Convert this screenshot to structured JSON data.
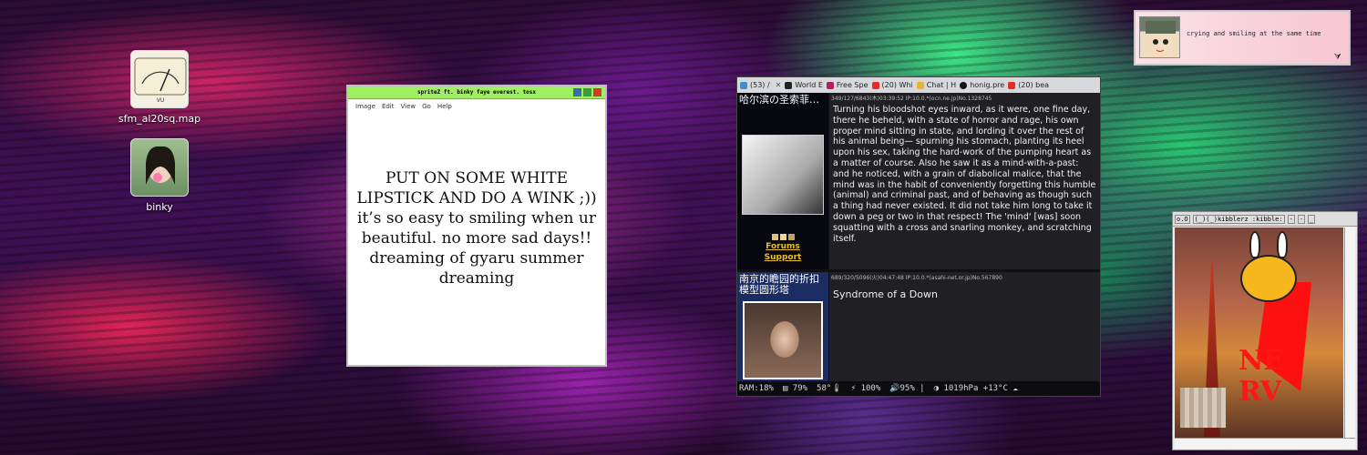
{
  "desktop": {
    "icons": [
      {
        "label": "sfm_al20sq.map",
        "icon": "vu-meter-icon"
      },
      {
        "label": "binky",
        "icon": "photo-icon"
      }
    ]
  },
  "viewer": {
    "title": "spriteZ ft. binky faye everest. tosx",
    "menu": [
      "Image",
      "Edit",
      "View",
      "Go",
      "Help"
    ],
    "text": "PUT ON SOME WHITE LIPSTICK AND DO A WINK ;)) it’s so easy to smiling when ur beautiful. no more sad days!! dreaming of gyaru summer dreaming"
  },
  "browser": {
    "tabs": [
      "(53) /",
      "World E",
      "Free Spe",
      "(20) Whi",
      "Chat | H",
      "honig.pre",
      "(20) bea"
    ],
    "posts": [
      {
        "side_title": "哈尔滨の圣索菲亚大教堂的贷款利…",
        "meta": "349/127/6843(木)03:39:52 IP:10.0.*(ocn.ne.jp)No.1328745",
        "forums_label": "Forums",
        "support_label": "Support",
        "body": "Turning his bloodshot eyes inward, as it were, one fine day, there he beheld, with a state of horror and rage, his own proper mind sitting in state, and lording it over the rest of his animal being— spurning his stomach, planting its heel upon his sex, taking the hard-work of the pumping heart as a matter of course. Also he saw it as a mind-with-a-past: and he noticed, with a grain of diabolical malice, that the mind was in the habit of conveniently forgetting this humble (animal) and criminal past, and of behaving as though such a thing had never existed. It did not take him long to take it down a peg or two in that respect! The 'mind' [was] soon squatting with a cross and snarling monkey, and scratching itself."
      },
      {
        "side_title": "南京的瞻园的折扣模型圆形塔",
        "meta": "689/320/5096(火)04:47:48 IP:10.0.*(asahi-net.or.jp)No.567890",
        "body": "Syndrome of a Down"
      }
    ],
    "status": {
      "ram": "RAM:18%",
      "disk": "79%",
      "temp": "58°",
      "power": "100%",
      "volume": "95%",
      "weather": "1019hPa +13°C"
    }
  },
  "notification": {
    "message": "crying and smiling at the same time"
  },
  "term": {
    "title_parts": [
      "o.O",
      "(_)(_)kibblerz :kibble:",
      "-",
      "-",
      "_"
    ]
  }
}
